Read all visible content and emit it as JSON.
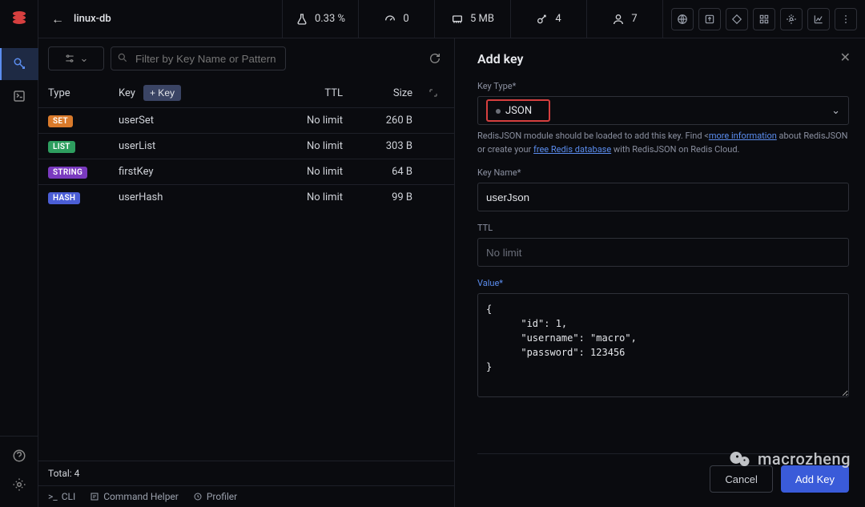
{
  "header": {
    "db_name": "linux-db",
    "stats": {
      "cpu": "0.33 %",
      "network": "0",
      "memory": "5 MB",
      "keys": "4",
      "users": "7"
    }
  },
  "keylist": {
    "filter_placeholder": "Filter by Key Name or Pattern",
    "columns": {
      "type": "Type",
      "key": "Key",
      "ttl": "TTL",
      "size": "Size"
    },
    "add_key_btn": "+ Key",
    "rows": [
      {
        "type": "SET",
        "badge_class": "badge-set",
        "key": "userSet",
        "ttl": "No limit",
        "size": "260 B"
      },
      {
        "type": "LIST",
        "badge_class": "badge-list",
        "key": "userList",
        "ttl": "No limit",
        "size": "303 B"
      },
      {
        "type": "STRING",
        "badge_class": "badge-string",
        "key": "firstKey",
        "ttl": "No limit",
        "size": "64 B"
      },
      {
        "type": "HASH",
        "badge_class": "badge-hash",
        "key": "userHash",
        "ttl": "No limit",
        "size": "99 B"
      }
    ],
    "total_label": "Total: 4"
  },
  "cmdbar": {
    "cli": "CLI",
    "helper": "Command Helper",
    "profiler": "Profiler"
  },
  "addkey": {
    "title": "Add key",
    "key_type_label": "Key Type*",
    "key_type_value": "JSON",
    "info_pre": "RedisJSON module should be loaded to add this key. Find ",
    "info_link1": "more information",
    "info_mid": " about RedisJSON or create your ",
    "info_link2": "free Redis database",
    "info_post": " with RedisJSON on Redis Cloud.",
    "key_name_label": "Key Name*",
    "key_name_value": "userJson",
    "ttl_label": "TTL",
    "ttl_placeholder": "No limit",
    "value_label": "Value*",
    "value_text": "{\n      \"id\": 1,\n      \"username\": \"macro\",\n      \"password\": 123456\n}",
    "cancel": "Cancel",
    "submit": "Add Key"
  },
  "watermark": "macrozheng"
}
